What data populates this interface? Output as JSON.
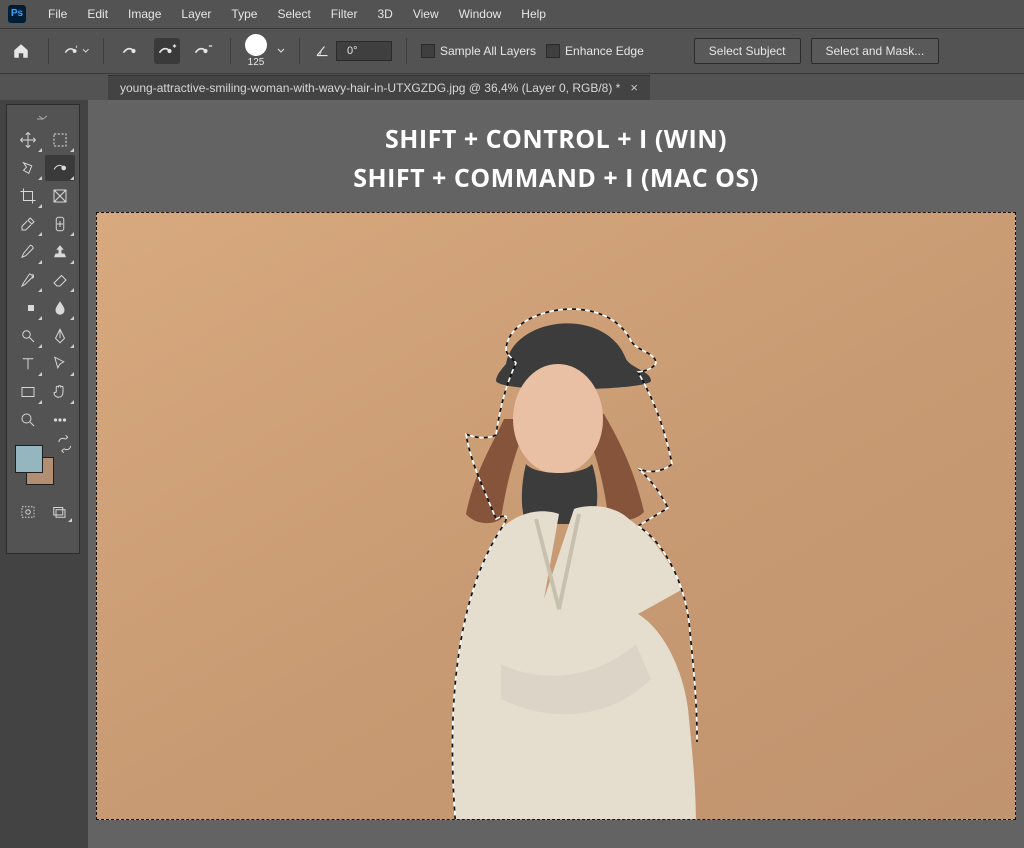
{
  "menu": [
    "File",
    "Edit",
    "Image",
    "Layer",
    "Type",
    "Select",
    "Filter",
    "3D",
    "View",
    "Window",
    "Help"
  ],
  "options": {
    "brush_size": "125",
    "angle": "0°",
    "sample_all_layers": "Sample All Layers",
    "enhance_edge": "Enhance Edge",
    "select_subject": "Select Subject",
    "select_and_mask": "Select and Mask..."
  },
  "tab": {
    "title": "young-attractive-smiling-woman-with-wavy-hair-in-UTXGZDG.jpg @ 36,4% (Layer 0, RGB/8) *"
  },
  "overlay": {
    "line1": "SHIFT + CONTROL + I (WIN)",
    "line2": "SHIFT + COMMAND + I (MAC OS)"
  },
  "colors": {
    "foreground": "#95B5BF",
    "background": "#B28F72"
  }
}
